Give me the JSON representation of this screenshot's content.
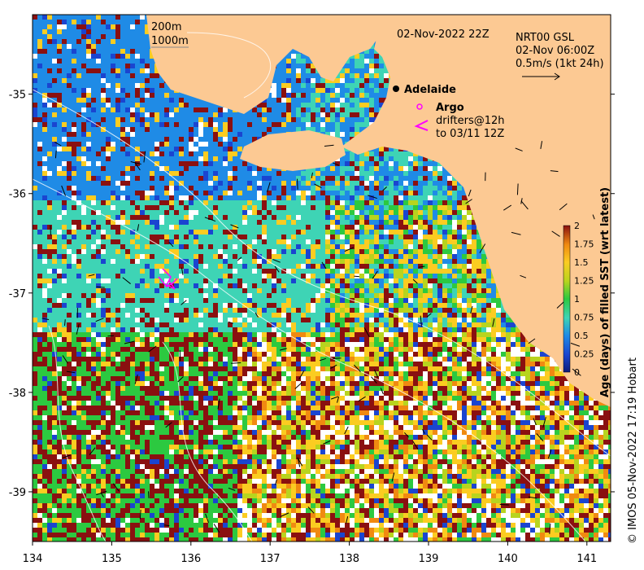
{
  "map": {
    "title_datetime": "02-Nov-2022 22Z",
    "isobath_labels": [
      "200m",
      "1000m"
    ],
    "product": {
      "name": "NRT00 GSL",
      "time": "02-Nov 06:00Z",
      "scale_label": "0.5m/s (1kt 24h)"
    },
    "places": [
      {
        "name": "Adelaide",
        "lon": 138.6,
        "lat": -34.93
      }
    ],
    "legend": {
      "argo_label": "Argo",
      "drifters_label_line1": "drifters@12h",
      "drifters_label_line2": "to 03/11 12Z",
      "argo_color": "#ff00ff",
      "drifter_color": "#ff00ff"
    },
    "x_axis": {
      "range": [
        134,
        141.3
      ],
      "ticks": [
        "134",
        "135",
        "136",
        "137",
        "138",
        "139",
        "140",
        "141"
      ]
    },
    "y_axis": {
      "range": [
        -39.5,
        -34.2
      ],
      "ticks": [
        "-35",
        "-36",
        "-37",
        "-38",
        "-39"
      ]
    },
    "colorbar": {
      "label": "Age (days) of filled SST (wrt latest)",
      "range": [
        0,
        2
      ],
      "ticks": [
        "0",
        "0.25",
        "0.5",
        "0.75",
        "1",
        "1.25",
        "1.5",
        "1.75",
        "2"
      ]
    },
    "credit": "© IMOS 05-Nov-2022 17:19 Hobart",
    "land_color": "#fcc993"
  }
}
